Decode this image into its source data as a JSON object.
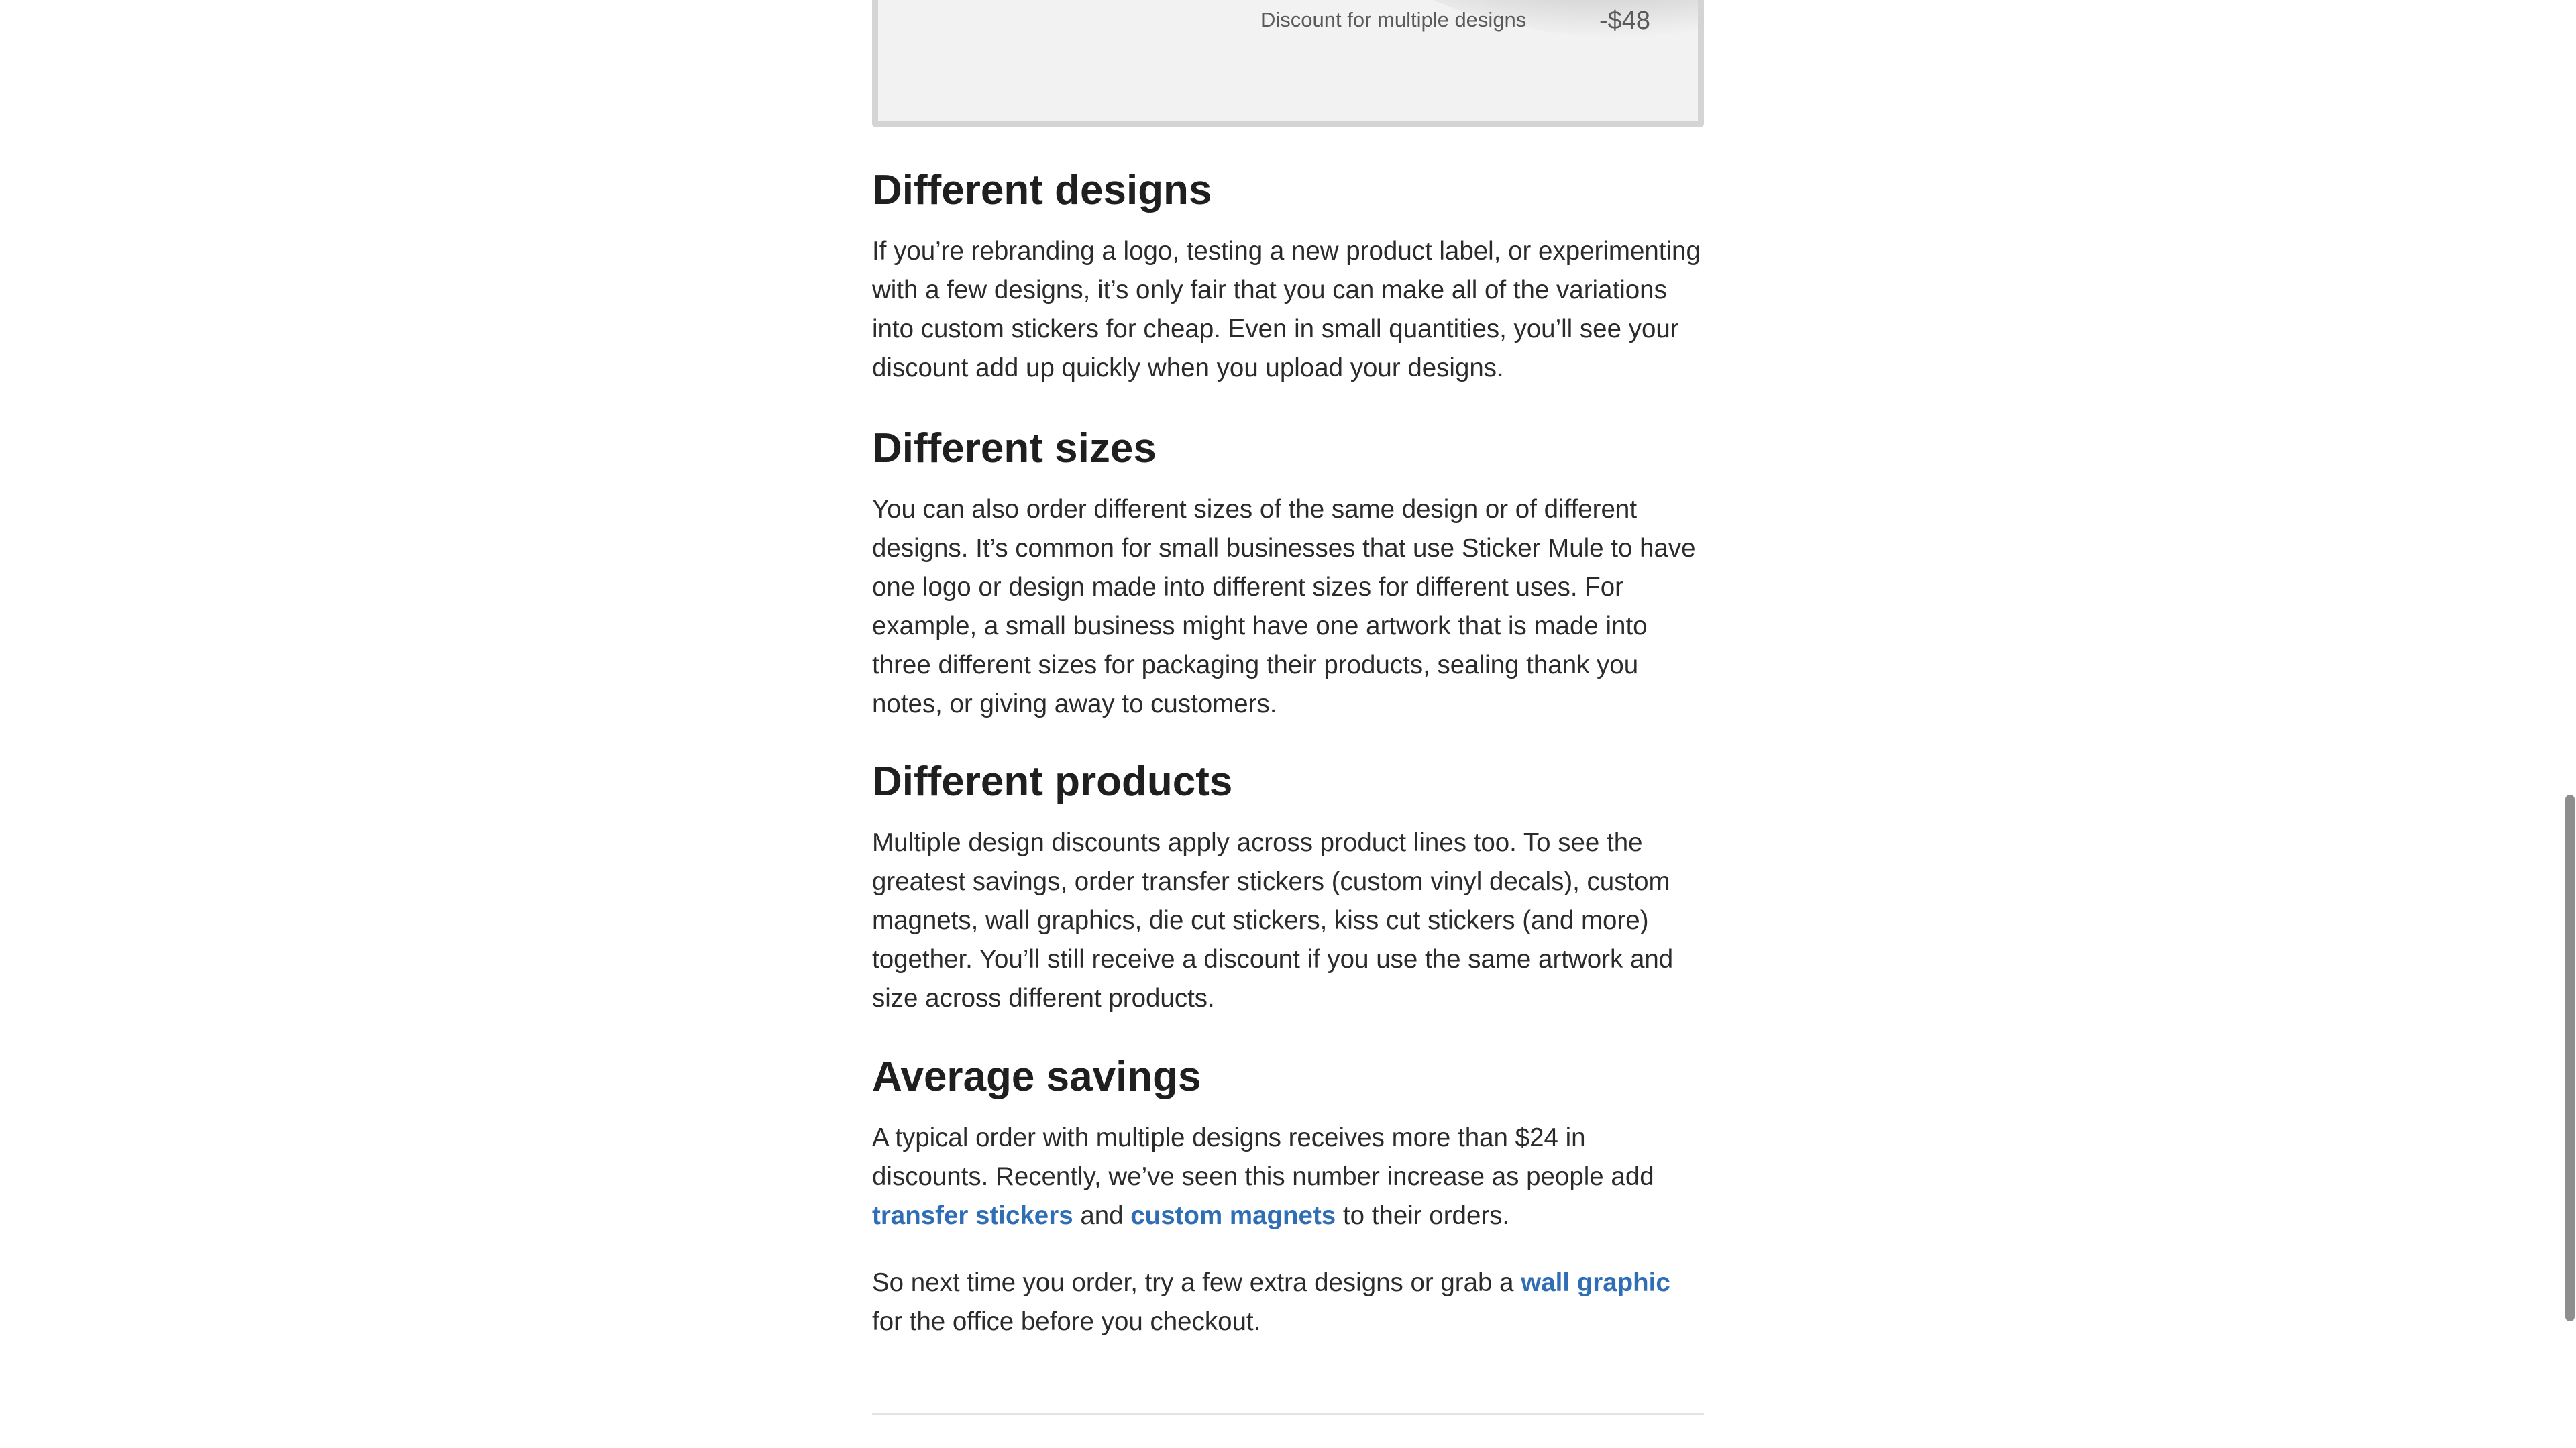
{
  "hero": {
    "discount_label": "Discount for multiple designs",
    "discount_amount": "-$48"
  },
  "sections": [
    {
      "heading": "Different designs",
      "body": "If you’re rebranding a logo, testing a new product label, or experimenting with a few designs, it’s only fair that you can make all of the variations into custom stickers for cheap. Even in small quantities, you’ll see your discount add up quickly when you upload your designs."
    },
    {
      "heading": "Different sizes",
      "body": "You can also order different sizes of the same design or of different designs. It’s common for small businesses that use Sticker Mule to have one logo or design made into different sizes for different uses. For example, a small business might have one artwork that is made into three different sizes for packaging their products, sealing thank you notes, or giving away to customers."
    },
    {
      "heading": "Different products",
      "body": "Multiple design discounts apply across product lines too. To see the greatest savings, order transfer stickers (custom vinyl decals), custom magnets, wall graphics, die cut stickers, kiss cut stickers (and more) together. You’ll still receive a discount if you use the same artwork and size across different products."
    },
    {
      "heading": "Average savings",
      "body_before_link1": "A typical order with multiple designs receives more than $24 in discounts. Recently, we’ve seen this number increase as people add ",
      "link1": "transfer stickers",
      "body_between": " and ",
      "link2": "custom magnets",
      "body_after": " to their orders."
    }
  ],
  "closing": {
    "before_link": "So next time you order, try a few extra designs or grab a ",
    "link": "wall graphic",
    "after_link": " for the office before you checkout."
  },
  "colors": {
    "link": "#2f6db5",
    "heading": "#1f1f1f",
    "body_text": "#2b2b2b"
  }
}
